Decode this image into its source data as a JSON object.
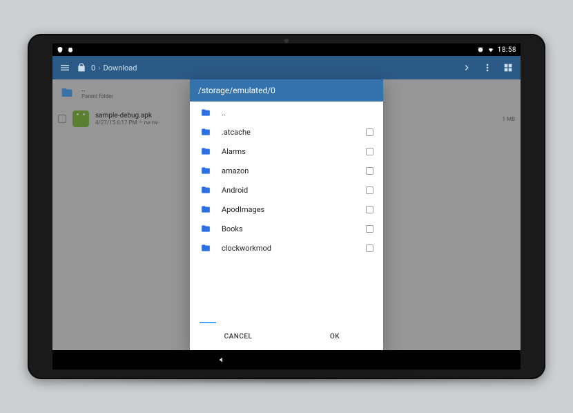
{
  "statusbar": {
    "time": "18:58"
  },
  "appbar": {
    "crumbs": [
      "0",
      "Download"
    ]
  },
  "bg": {
    "parent_label": "..",
    "parent_sub": "Parent folder",
    "file_name": "sample-debug.apk",
    "file_meta": "4/27/15 6:17 PM — rw-rw-",
    "file_size": "1 MB"
  },
  "dialog": {
    "path": "/storage/emulated/0",
    "items": [
      {
        "label": ".."
      },
      {
        "label": ".atcache"
      },
      {
        "label": "Alarms"
      },
      {
        "label": "amazon"
      },
      {
        "label": "Android"
      },
      {
        "label": "ApodImages"
      },
      {
        "label": "Books"
      },
      {
        "label": "clockworkmod"
      }
    ],
    "cancel": "CANCEL",
    "ok": "OK"
  }
}
